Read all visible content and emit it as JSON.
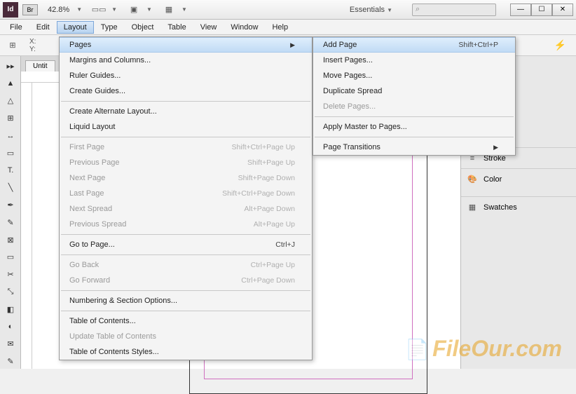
{
  "titlebar": {
    "app_abbr": "Id",
    "bridge": "Br",
    "zoom": "42.8%",
    "workspace": "Essentials",
    "search_placeholder": "⌕"
  },
  "menubar": [
    "File",
    "Edit",
    "Layout",
    "Type",
    "Object",
    "Table",
    "View",
    "Window",
    "Help"
  ],
  "menubar_active_index": 2,
  "coord": {
    "x_label": "X:",
    "y_label": "Y:"
  },
  "tab": {
    "title": "Untit"
  },
  "layout_menu": [
    {
      "label": "Pages",
      "submenu": true,
      "hover": true
    },
    {
      "label": "Margins and Columns..."
    },
    {
      "label": "Ruler Guides..."
    },
    {
      "label": "Create Guides..."
    },
    {
      "sep": true
    },
    {
      "label": "Create Alternate Layout..."
    },
    {
      "label": "Liquid Layout"
    },
    {
      "sep": true
    },
    {
      "label": "First Page",
      "shortcut": "Shift+Ctrl+Page Up",
      "disabled": true
    },
    {
      "label": "Previous Page",
      "shortcut": "Shift+Page Up",
      "disabled": true
    },
    {
      "label": "Next Page",
      "shortcut": "Shift+Page Down",
      "disabled": true
    },
    {
      "label": "Last Page",
      "shortcut": "Shift+Ctrl+Page Down",
      "disabled": true
    },
    {
      "label": "Next Spread",
      "shortcut": "Alt+Page Down",
      "disabled": true
    },
    {
      "label": "Previous Spread",
      "shortcut": "Alt+Page Up",
      "disabled": true
    },
    {
      "sep": true
    },
    {
      "label": "Go to Page...",
      "shortcut": "Ctrl+J"
    },
    {
      "sep": true
    },
    {
      "label": "Go Back",
      "shortcut": "Ctrl+Page Up",
      "disabled": true
    },
    {
      "label": "Go Forward",
      "shortcut": "Ctrl+Page Down",
      "disabled": true
    },
    {
      "sep": true
    },
    {
      "label": "Numbering & Section Options..."
    },
    {
      "sep": true
    },
    {
      "label": "Table of Contents..."
    },
    {
      "label": "Update Table of Contents",
      "disabled": true
    },
    {
      "label": "Table of Contents Styles..."
    }
  ],
  "pages_menu": [
    {
      "label": "Add Page",
      "shortcut": "Shift+Ctrl+P",
      "hover": true
    },
    {
      "label": "Insert Pages..."
    },
    {
      "label": "Move Pages..."
    },
    {
      "label": "Duplicate Spread"
    },
    {
      "label": "Delete Pages...",
      "disabled": true
    },
    {
      "sep": true
    },
    {
      "label": "Apply Master to Pages..."
    },
    {
      "sep": true
    },
    {
      "label": "Page Transitions",
      "submenu": true
    }
  ],
  "panels": [
    "Stroke",
    "Color",
    "Swatches"
  ],
  "watermark": "FileOur.com"
}
